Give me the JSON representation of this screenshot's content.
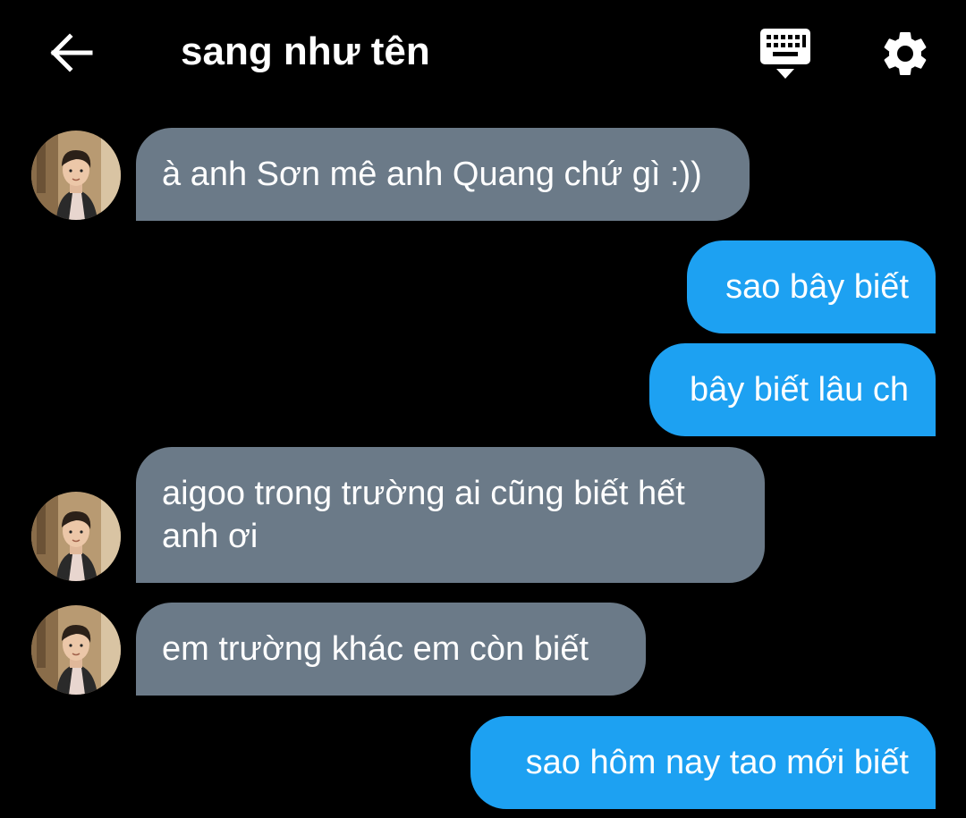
{
  "header": {
    "back_icon": "arrow-left-icon",
    "title": "sang như tên",
    "keyboard_icon": "keyboard-icon",
    "settings_icon": "gear-icon"
  },
  "colors": {
    "background": "#000000",
    "incoming_bubble": "#6b7a88",
    "outgoing_bubble": "#1da1f2",
    "text": "#ffffff"
  },
  "messages": [
    {
      "direction": "incoming",
      "text": "à anh Sơn mê anh Quang chứ gì :))"
    },
    {
      "direction": "outgoing",
      "text": "sao bây biết"
    },
    {
      "direction": "outgoing",
      "text": "bây biết lâu ch"
    },
    {
      "direction": "incoming",
      "lines": [
        "aigoo trong trường ai cũng biết hết",
        "anh ơi"
      ]
    },
    {
      "direction": "incoming",
      "text": "em trường khác em còn biết"
    },
    {
      "direction": "outgoing",
      "text": "sao hôm nay tao mới biết"
    }
  ]
}
